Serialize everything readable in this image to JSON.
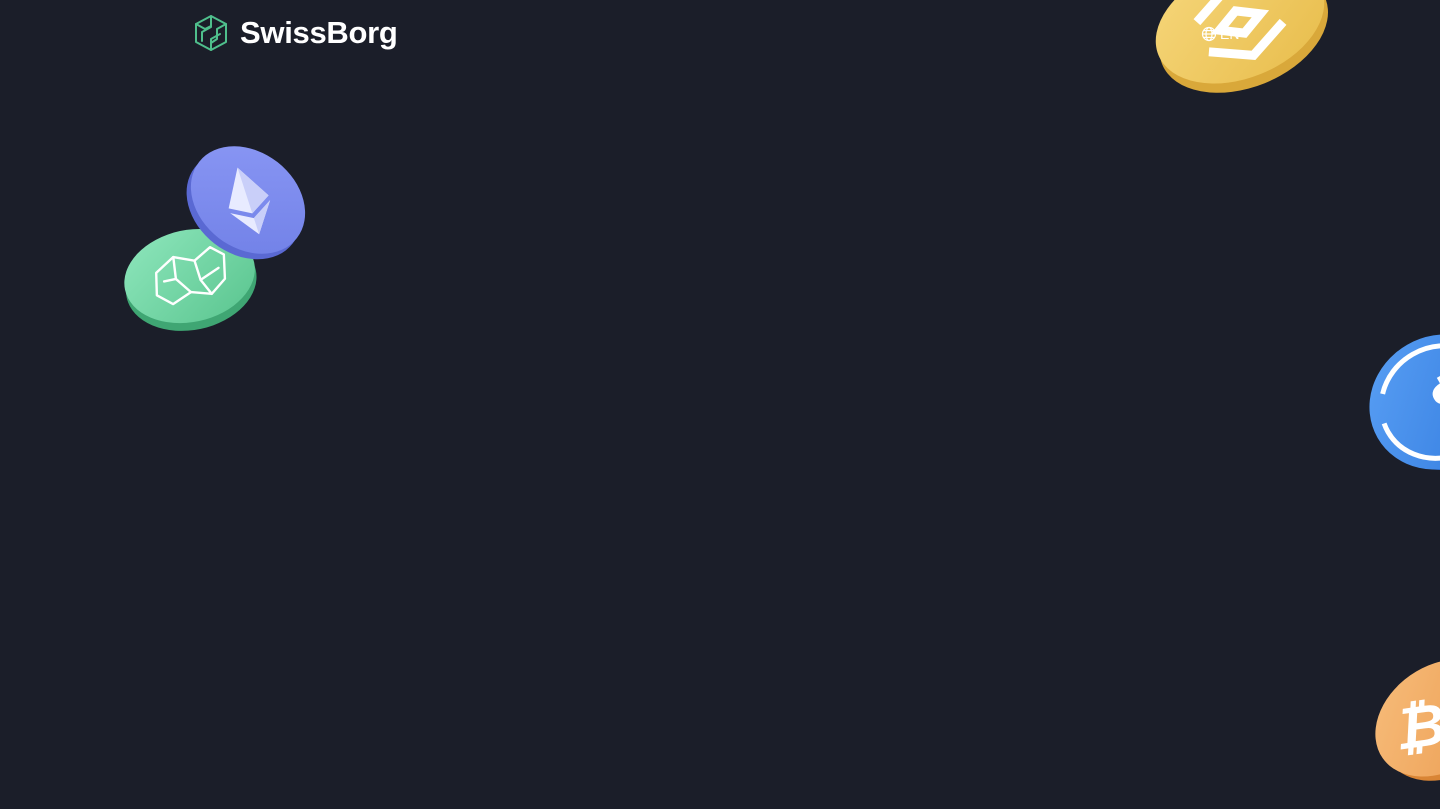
{
  "brand": {
    "name": "SwissBorg",
    "accent": "#4fbf8c"
  },
  "language": {
    "current": "EN",
    "icon": "globe-icon"
  },
  "coins": [
    {
      "name": "ethereum",
      "icon": "ethereum-icon",
      "color": "#7c8bef"
    },
    {
      "name": "swissborg",
      "icon": "swissborg-icon",
      "color": "#6dd3a0"
    },
    {
      "name": "binance",
      "icon": "binance-icon",
      "color": "#f0c75a"
    },
    {
      "name": "usdc",
      "icon": "usdc-icon",
      "color": "#3e87e8"
    },
    {
      "name": "bitcoin",
      "icon": "bitcoin-icon",
      "color": "#f3ad66"
    }
  ],
  "background": "#1b1e29"
}
